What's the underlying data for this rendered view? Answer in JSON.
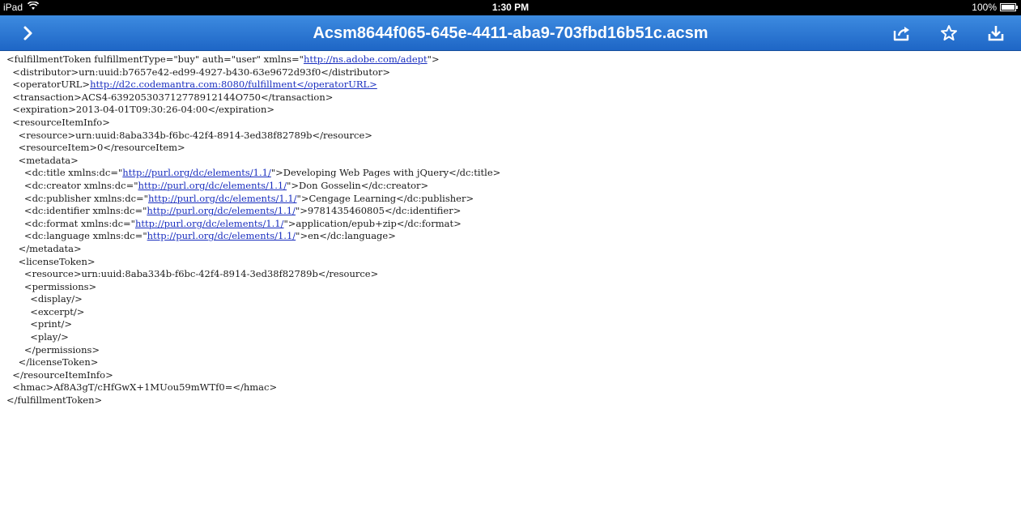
{
  "status_bar": {
    "device": "iPad",
    "time": "1:30 PM",
    "battery": "100%",
    "battery_level": 1.0
  },
  "nav_bar": {
    "title": "Acsm8644f065-645e-4411-aba9-703fbd16b51c.acsm",
    "back_icon": "chevron-right-icon",
    "actions": [
      "share-icon",
      "star-icon",
      "download-icon"
    ]
  },
  "document": {
    "lines": [
      [
        {
          "t": "<fulfillmentToken fulfillmentType=\"buy\" auth=\"user\" xmlns=\""
        },
        {
          "link": "http://ns.adobe.com/adept"
        },
        {
          "t": "\">"
        }
      ],
      [
        {
          "t": "  <distributor>urn:uuid:b7657e42-ed99-4927-b430-63e9672d93f0</distributor>"
        }
      ],
      [
        {
          "t": "  <operatorURL>"
        },
        {
          "link": "http://d2c.codemantra.com:8080/fulfillment</operatorURL>"
        }
      ],
      [
        {
          "t": "  <transaction>ACS4-639205303712778912144O750</transaction>"
        }
      ],
      [
        {
          "t": "  <expiration>2013-04-01T09:30:26-04:00</expiration>"
        }
      ],
      [
        {
          "t": "  <resourceItemInfo>"
        }
      ],
      [
        {
          "t": "    <resource>urn:uuid:8aba334b-f6bc-42f4-8914-3ed38f82789b</resource>"
        }
      ],
      [
        {
          "t": "    <resourceItem>0</resourceItem>"
        }
      ],
      [
        {
          "t": "    <metadata>"
        }
      ],
      [
        {
          "t": "      <dc:title xmlns:dc=\""
        },
        {
          "link": "http://purl.org/dc/elements/1.1/"
        },
        {
          "t": "\">Developing Web Pages with jQuery</dc:title>"
        }
      ],
      [
        {
          "t": "      <dc:creator xmlns:dc=\""
        },
        {
          "link": "http://purl.org/dc/elements/1.1/"
        },
        {
          "t": "\">Don Gosselin</dc:creator>"
        }
      ],
      [
        {
          "t": "      <dc:publisher xmlns:dc=\""
        },
        {
          "link": "http://purl.org/dc/elements/1.1/"
        },
        {
          "t": "\">Cengage Learning</dc:publisher>"
        }
      ],
      [
        {
          "t": "      <dc:identifier xmlns:dc=\""
        },
        {
          "link": "http://purl.org/dc/elements/1.1/"
        },
        {
          "t": "\">9781435460805</dc:identifier>"
        }
      ],
      [
        {
          "t": "      <dc:format xmlns:dc=\""
        },
        {
          "link": "http://purl.org/dc/elements/1.1/"
        },
        {
          "t": "\">application/epub+zip</dc:format>"
        }
      ],
      [
        {
          "t": "      <dc:language xmlns:dc=\""
        },
        {
          "link": "http://purl.org/dc/elements/1.1/"
        },
        {
          "t": "\">en</dc:language>"
        }
      ],
      [
        {
          "t": "    </metadata>"
        }
      ],
      [
        {
          "t": "    <licenseToken>"
        }
      ],
      [
        {
          "t": "      <resource>urn:uuid:8aba334b-f6bc-42f4-8914-3ed38f82789b</resource>"
        }
      ],
      [
        {
          "t": "      <permissions>"
        }
      ],
      [
        {
          "t": "        <display/>"
        }
      ],
      [
        {
          "t": "        <excerpt/>"
        }
      ],
      [
        {
          "t": "        <print/>"
        }
      ],
      [
        {
          "t": "        <play/>"
        }
      ],
      [
        {
          "t": "      </permissions>"
        }
      ],
      [
        {
          "t": "    </licenseToken>"
        }
      ],
      [
        {
          "t": "  </resourceItemInfo>"
        }
      ],
      [
        {
          "t": "  <hmac>Af8A3gT/cHfGwX+1MUou59mWTf0=</hmac>"
        }
      ],
      [
        {
          "t": "</fulfillmentToken>"
        }
      ]
    ]
  }
}
